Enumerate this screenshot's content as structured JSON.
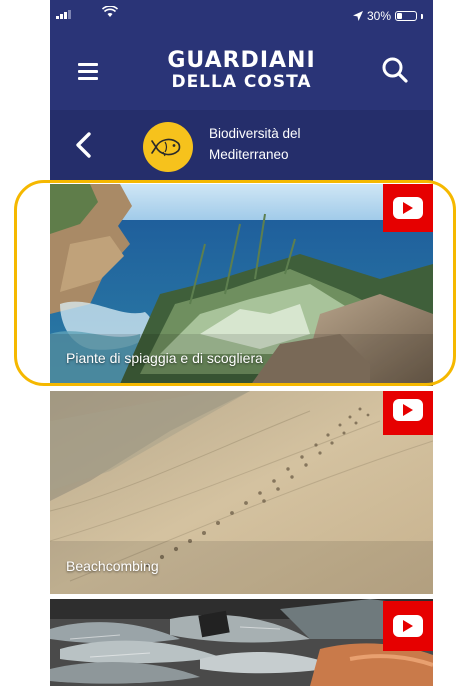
{
  "status_bar": {
    "battery_text": "30%",
    "battery_level": 0.3,
    "icons": [
      "signal-icon",
      "wifi-icon",
      "location-arrow-icon",
      "battery-icon"
    ]
  },
  "header": {
    "brand_line1": "GUARDIANI",
    "brand_line2": "DELLA COSTA",
    "icons": [
      "menu-icon",
      "search-icon"
    ]
  },
  "sub_header": {
    "title_line1": "Biodiversità del",
    "title_line2": "Mediterraneo",
    "icons": [
      "back-chevron-icon",
      "fish-icon"
    ]
  },
  "videos": [
    {
      "title": "Piante di spiaggia e di scogliera",
      "icon": "youtube-icon"
    },
    {
      "title": "Beachcombing",
      "icon": "youtube-icon"
    },
    {
      "title": "",
      "icon": "youtube-icon"
    }
  ],
  "colors": {
    "header_bg": "#2a3477",
    "subheader_bg": "#252e6b",
    "badge_yellow": "#f6c21c",
    "youtube_red": "#e60000",
    "highlight": "#f5b800"
  }
}
